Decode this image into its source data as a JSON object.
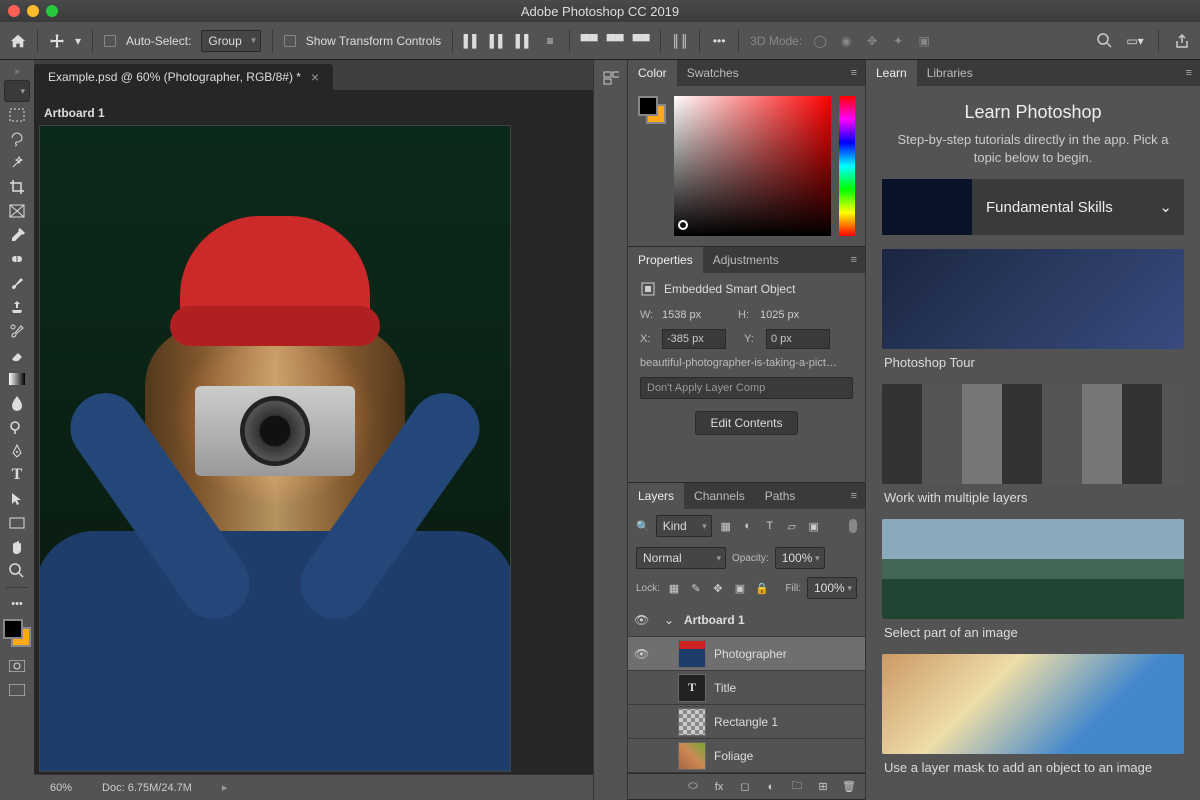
{
  "app_title": "Adobe Photoshop CC 2019",
  "optionbar": {
    "autoselect": "Auto-Select:",
    "group": "Group",
    "showtransform": "Show Transform Controls",
    "mode3d": "3D Mode:"
  },
  "doc": {
    "tab": "Example.psd @ 60% (Photographer, RGB/8#) *",
    "artboard": "Artboard 1",
    "zoom": "60%",
    "docinfo": "Doc: 6.75M/24.7M"
  },
  "panels": {
    "color": {
      "tab1": "Color",
      "tab2": "Swatches"
    },
    "properties": {
      "tab1": "Properties",
      "tab2": "Adjustments",
      "type": "Embedded Smart Object",
      "w_lbl": "W:",
      "w_val": "1538 px",
      "h_lbl": "H:",
      "h_val": "1025 px",
      "x_lbl": "X:",
      "x_val": "-385 px",
      "y_lbl": "Y:",
      "y_val": "0 px",
      "filename": "beautiful-photographer-is-taking-a-pict…",
      "layercomp": "Don't Apply Layer Comp",
      "editbtn": "Edit Contents"
    },
    "layers": {
      "tab1": "Layers",
      "tab2": "Channels",
      "tab3": "Paths",
      "kind": "Kind",
      "blend": "Normal",
      "opacity_lbl": "Opacity:",
      "opacity_val": "100%",
      "lock_lbl": "Lock:",
      "fill_lbl": "Fill:",
      "fill_val": "100%",
      "items": [
        {
          "name": "Artboard 1",
          "vis": true,
          "artboard": true
        },
        {
          "name": "Photographer",
          "vis": true,
          "sel": true,
          "thumb": "photo"
        },
        {
          "name": "Title",
          "vis": false,
          "thumb": "T"
        },
        {
          "name": "Rectangle 1",
          "vis": false,
          "thumb": "rect"
        },
        {
          "name": "Foliage",
          "vis": false,
          "thumb": "foliage"
        }
      ]
    }
  },
  "learn": {
    "tab1": "Learn",
    "tab2": "Libraries",
    "heading": "Learn Photoshop",
    "intro": "Step-by-step tutorials directly in the app. Pick a topic below to begin.",
    "accordion": "Fundamental Skills",
    "cards": [
      {
        "label": "Photoshop Tour"
      },
      {
        "label": "Work with multiple layers"
      },
      {
        "label": "Select part of an image"
      },
      {
        "label": "Use a layer mask to add an object to an image"
      }
    ]
  }
}
